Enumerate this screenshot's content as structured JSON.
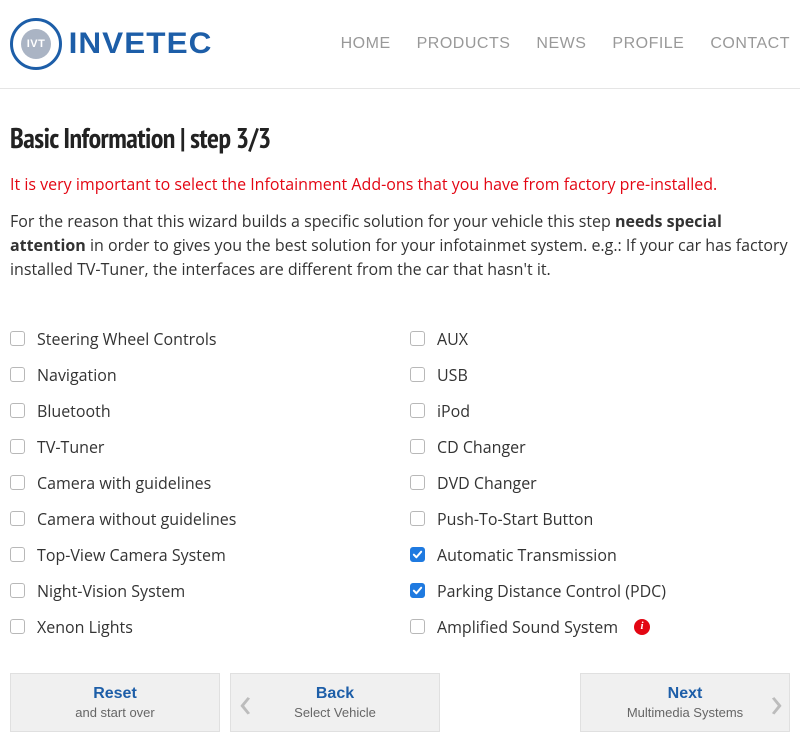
{
  "brand": "INVETEC",
  "nav": {
    "home": "HOME",
    "products": "PRODUCTS",
    "news": "NEWS",
    "profile": "PROFILE",
    "contact": "CONTACT"
  },
  "title": "Basic Information | step 3/3",
  "alert": "It is very important to select the Infotainment Add-ons that you have from factory pre-installed.",
  "intro_a": "For the reason that this wizard builds a specific solution for your vehicle this step ",
  "intro_b": "needs special attention",
  "intro_c": " in order to gives you the best solution for your infotainmet system. e.g.: If your car has factory installed TV-Tuner, the interfaces are different from the car that hasn't it.",
  "options_left": [
    {
      "label": "Steering Wheel Controls",
      "checked": false
    },
    {
      "label": "Navigation",
      "checked": false
    },
    {
      "label": "Bluetooth",
      "checked": false
    },
    {
      "label": "TV-Tuner",
      "checked": false
    },
    {
      "label": "Camera with guidelines",
      "checked": false
    },
    {
      "label": "Camera without guidelines",
      "checked": false
    },
    {
      "label": "Top-View Camera System",
      "checked": false
    },
    {
      "label": "Night-Vision System",
      "checked": false
    },
    {
      "label": "Xenon Lights",
      "checked": false
    }
  ],
  "options_right": [
    {
      "label": "AUX",
      "checked": false
    },
    {
      "label": "USB",
      "checked": false
    },
    {
      "label": "iPod",
      "checked": false
    },
    {
      "label": "CD Changer",
      "checked": false
    },
    {
      "label": "DVD Changer",
      "checked": false
    },
    {
      "label": "Push-To-Start Button",
      "checked": false
    },
    {
      "label": "Automatic Transmission",
      "checked": true
    },
    {
      "label": "Parking Distance Control (PDC)",
      "checked": true
    },
    {
      "label": "Amplified Sound System",
      "checked": false,
      "info": true
    }
  ],
  "buttons": {
    "reset": {
      "main": "Reset",
      "sub": "and start over"
    },
    "back": {
      "main": "Back",
      "sub": "Select Vehicle"
    },
    "next": {
      "main": "Next",
      "sub": "Multimedia Systems"
    }
  }
}
